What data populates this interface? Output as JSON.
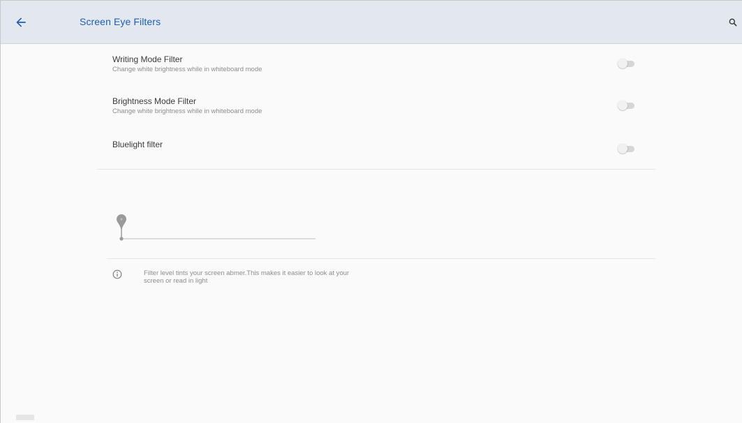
{
  "appbar": {
    "title": "Screen Eye Filters",
    "back_icon": "arrow-left-icon",
    "search_icon": "search-icon",
    "title_color": "#1f5fae",
    "accent": "#1f5fae"
  },
  "settings": [
    {
      "title": "Writing Mode Filter",
      "subtitle": "Change white brightness while in whiteboard mode",
      "enabled": false
    },
    {
      "title": "Brightness Mode Filter",
      "subtitle": "Change white brightness while in whiteboard mode",
      "enabled": false
    },
    {
      "title": "Bluelight filter",
      "subtitle": "",
      "enabled": false
    }
  ],
  "filter_level": {
    "value": 0,
    "min": 0,
    "max": 100
  },
  "info": {
    "icon": "info-icon",
    "text": "Filter level tints your screen abmer.This makes it easier to look at your screen or read in light"
  }
}
